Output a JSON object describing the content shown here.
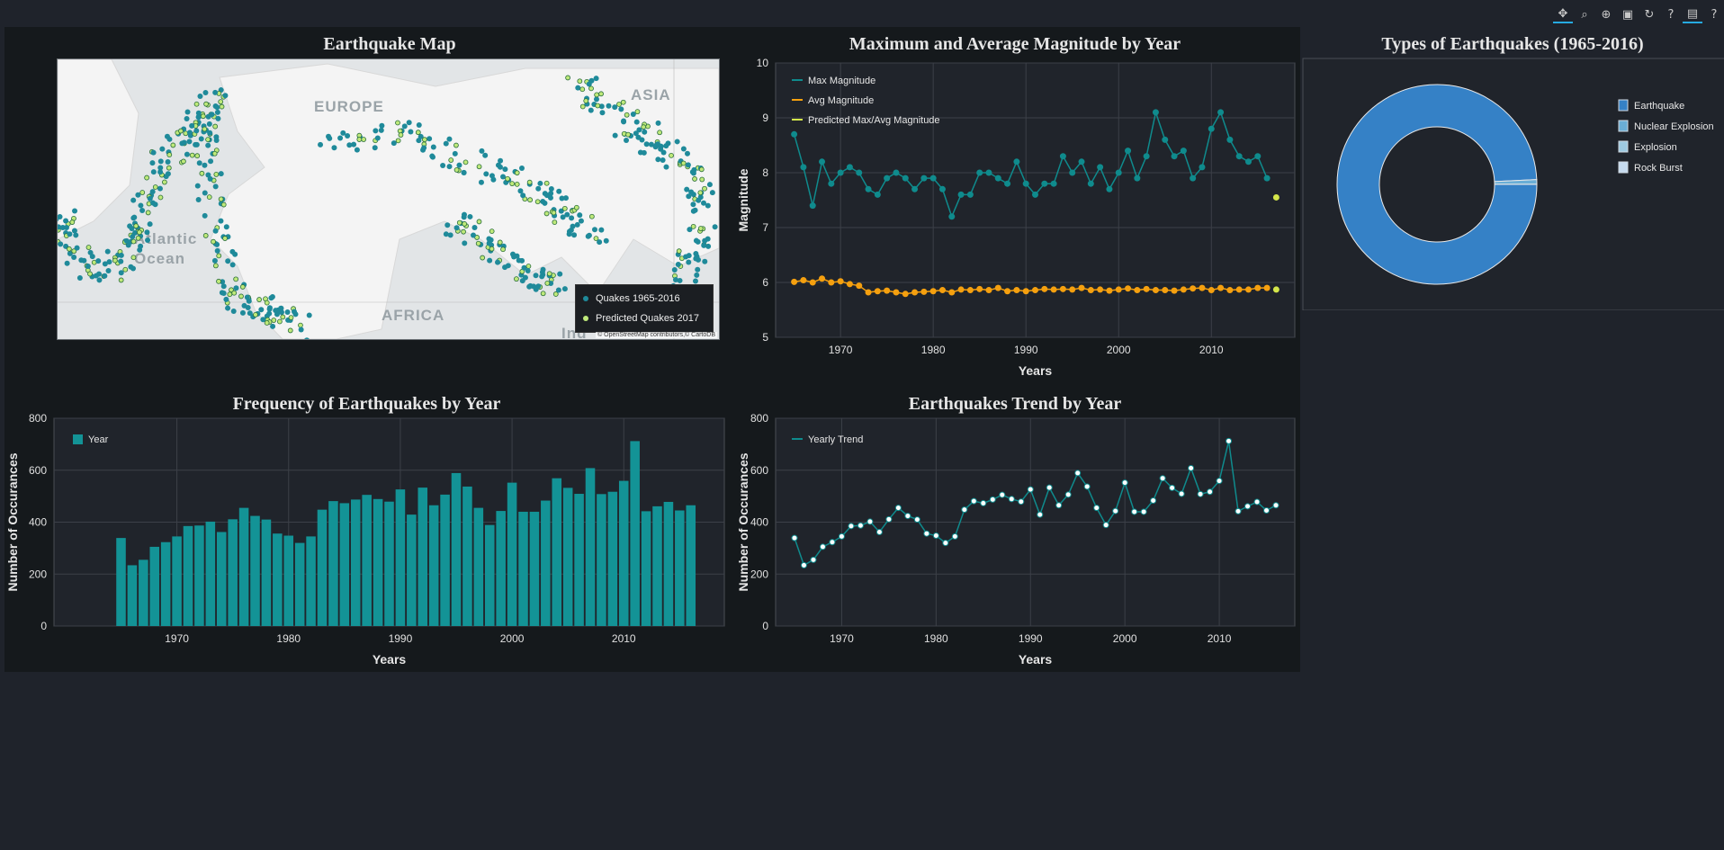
{
  "toolbar": {
    "tools": [
      "pan-icon",
      "box-zoom-icon",
      "wheel-zoom-icon",
      "save-icon",
      "reset-icon",
      "help-icon",
      "hover-icon",
      "help-icon-2"
    ]
  },
  "colors": {
    "teal": "#0f8b8d",
    "teal_bar": "#139396",
    "orange": "#f5a00f",
    "yellowgreen": "#d4e64a",
    "donut_earthquake": "#3581c6",
    "donut_nuclear": "#6aaed6",
    "donut_explosion": "#9ecae1",
    "donut_rockburst": "#c6dbef"
  },
  "map": {
    "title": "Earthquake Map",
    "labels": {
      "europe": "EUROPE",
      "asia": "ASIA",
      "africa": "AFRICA",
      "atlantic": "Atlantic",
      "ocean": "Ocean",
      "ind": "Ind"
    },
    "legend": [
      {
        "label": "Quakes 1965-2016",
        "color": "#1f8a9a"
      },
      {
        "label": "Predicted Quakes 2017",
        "color": "#bfe97a"
      }
    ],
    "attribution": "© OpenStreetMap contributors,© CartoDB"
  },
  "magnitude": {
    "title": "Maximum and Average Magnitude by Year",
    "xlabel": "Years",
    "ylabel": "Magnitude",
    "legend": [
      "Max Magnitude",
      "Avg Magnitude",
      "Predicted Max/Avg Magnitude"
    ]
  },
  "types": {
    "title": "Types of Earthquakes (1965-2016)",
    "legend": [
      "Earthquake",
      "Nuclear Explosion",
      "Explosion",
      "Rock Burst"
    ]
  },
  "frequency": {
    "title": "Frequency of Earthquakes by Year",
    "xlabel": "Years",
    "ylabel": "Number of Occurances",
    "legend": "Year"
  },
  "trend": {
    "title": "Earthquakes Trend by Year",
    "xlabel": "Years",
    "ylabel": "Number of Occurances",
    "legend": "Yearly Trend"
  },
  "chart_data": [
    {
      "type": "line",
      "title": "Maximum and Average Magnitude by Year",
      "xlabel": "Years",
      "ylabel": "Magnitude",
      "xlim": [
        1963,
        2019
      ],
      "ylim": [
        5,
        10
      ],
      "xticks": [
        1970,
        1980,
        1990,
        2000,
        2010
      ],
      "yticks": [
        5,
        6,
        7,
        8,
        9,
        10
      ],
      "grid": true,
      "legend_position": "top-left",
      "x": [
        1965,
        1966,
        1967,
        1968,
        1969,
        1970,
        1971,
        1972,
        1973,
        1974,
        1975,
        1976,
        1977,
        1978,
        1979,
        1980,
        1981,
        1982,
        1983,
        1984,
        1985,
        1986,
        1987,
        1988,
        1989,
        1990,
        1991,
        1992,
        1993,
        1994,
        1995,
        1996,
        1997,
        1998,
        1999,
        2000,
        2001,
        2002,
        2003,
        2004,
        2005,
        2006,
        2007,
        2008,
        2009,
        2010,
        2011,
        2012,
        2013,
        2014,
        2015,
        2016
      ],
      "series": [
        {
          "name": "Max Magnitude",
          "values": [
            8.7,
            8.1,
            7.4,
            8.2,
            7.8,
            8.0,
            8.1,
            8.0,
            7.7,
            7.6,
            7.9,
            8.0,
            7.9,
            7.7,
            7.9,
            7.9,
            7.7,
            7.2,
            7.6,
            7.6,
            8.0,
            8.0,
            7.9,
            7.8,
            8.2,
            7.8,
            7.6,
            7.8,
            7.8,
            8.3,
            8.0,
            8.2,
            7.8,
            8.1,
            7.7,
            8.0,
            8.4,
            7.9,
            8.3,
            9.1,
            8.6,
            8.3,
            8.4,
            7.9,
            8.1,
            8.8,
            9.1,
            8.6,
            8.3,
            8.2,
            8.3,
            7.9
          ]
        },
        {
          "name": "Avg Magnitude",
          "values": [
            6.01,
            6.04,
            6.0,
            6.07,
            6.0,
            6.02,
            5.97,
            5.94,
            5.82,
            5.84,
            5.85,
            5.82,
            5.79,
            5.82,
            5.83,
            5.84,
            5.86,
            5.82,
            5.87,
            5.86,
            5.88,
            5.86,
            5.9,
            5.84,
            5.86,
            5.84,
            5.86,
            5.88,
            5.87,
            5.88,
            5.87,
            5.9,
            5.86,
            5.87,
            5.85,
            5.87,
            5.89,
            5.86,
            5.88,
            5.86,
            5.86,
            5.85,
            5.87,
            5.89,
            5.9,
            5.86,
            5.9,
            5.86,
            5.87,
            5.87,
            5.9,
            5.9
          ]
        },
        {
          "name": "Predicted Max/Avg Magnitude",
          "x": [
            2017,
            2017
          ],
          "values": [
            7.55,
            5.87
          ]
        }
      ]
    },
    {
      "type": "pie",
      "title": "Types of Earthquakes (1965-2016)",
      "donut": true,
      "legend_position": "top-right",
      "categories": [
        "Earthquake",
        "Nuclear Explosion",
        "Explosion",
        "Rock Burst"
      ],
      "values": [
        23232,
        175,
        4,
        1
      ]
    },
    {
      "type": "bar",
      "title": "Frequency of Earthquakes by Year",
      "xlabel": "Years",
      "ylabel": "Number of Occurances",
      "xlim": [
        1959,
        2019
      ],
      "ylim": [
        0,
        800
      ],
      "xticks": [
        1970,
        1980,
        1990,
        2000,
        2010
      ],
      "yticks": [
        0,
        200,
        400,
        600,
        800
      ],
      "grid": true,
      "legend_position": "top-left",
      "categories": [
        1965,
        1966,
        1967,
        1968,
        1969,
        1970,
        1971,
        1972,
        1973,
        1974,
        1975,
        1976,
        1977,
        1978,
        1979,
        1980,
        1981,
        1982,
        1983,
        1984,
        1985,
        1986,
        1987,
        1988,
        1989,
        1990,
        1991,
        1992,
        1993,
        1994,
        1995,
        1996,
        1997,
        1998,
        1999,
        2000,
        2001,
        2002,
        2003,
        2004,
        2005,
        2006,
        2007,
        2008,
        2009,
        2010,
        2011,
        2012,
        2013,
        2014,
        2015,
        2016
      ],
      "series": [
        {
          "name": "Year",
          "values": [
            339,
            234,
            255,
            305,
            323,
            345,
            385,
            387,
            402,
            362,
            411,
            455,
            424,
            410,
            356,
            348,
            320,
            345,
            448,
            481,
            473,
            487,
            505,
            489,
            479,
            526,
            429,
            533,
            465,
            506,
            589,
            537,
            455,
            389,
            443,
            552,
            440,
            440,
            483,
            569,
            532,
            509,
            608,
            508,
            517,
            559,
            712,
            442,
            461,
            478,
            445,
            465
          ]
        }
      ]
    },
    {
      "type": "line",
      "title": "Earthquakes Trend by Year",
      "xlabel": "Years",
      "ylabel": "Number of Occurances",
      "xlim": [
        1963,
        2018
      ],
      "ylim": [
        0,
        800
      ],
      "xticks": [
        1970,
        1980,
        1990,
        2000,
        2010
      ],
      "yticks": [
        0,
        200,
        400,
        600,
        800
      ],
      "grid": true,
      "legend_position": "top-left",
      "x": [
        1965,
        1966,
        1967,
        1968,
        1969,
        1970,
        1971,
        1972,
        1973,
        1974,
        1975,
        1976,
        1977,
        1978,
        1979,
        1980,
        1981,
        1982,
        1983,
        1984,
        1985,
        1986,
        1987,
        1988,
        1989,
        1990,
        1991,
        1992,
        1993,
        1994,
        1995,
        1996,
        1997,
        1998,
        1999,
        2000,
        2001,
        2002,
        2003,
        2004,
        2005,
        2006,
        2007,
        2008,
        2009,
        2010,
        2011,
        2012,
        2013,
        2014,
        2015,
        2016
      ],
      "series": [
        {
          "name": "Yearly Trend",
          "values": [
            339,
            234,
            255,
            305,
            323,
            345,
            385,
            387,
            402,
            362,
            411,
            455,
            424,
            410,
            356,
            348,
            320,
            345,
            448,
            481,
            473,
            487,
            505,
            489,
            479,
            526,
            429,
            533,
            465,
            506,
            589,
            537,
            455,
            389,
            443,
            552,
            440,
            440,
            483,
            569,
            532,
            509,
            608,
            508,
            517,
            559,
            712,
            442,
            461,
            478,
            445,
            465
          ]
        }
      ]
    }
  ]
}
